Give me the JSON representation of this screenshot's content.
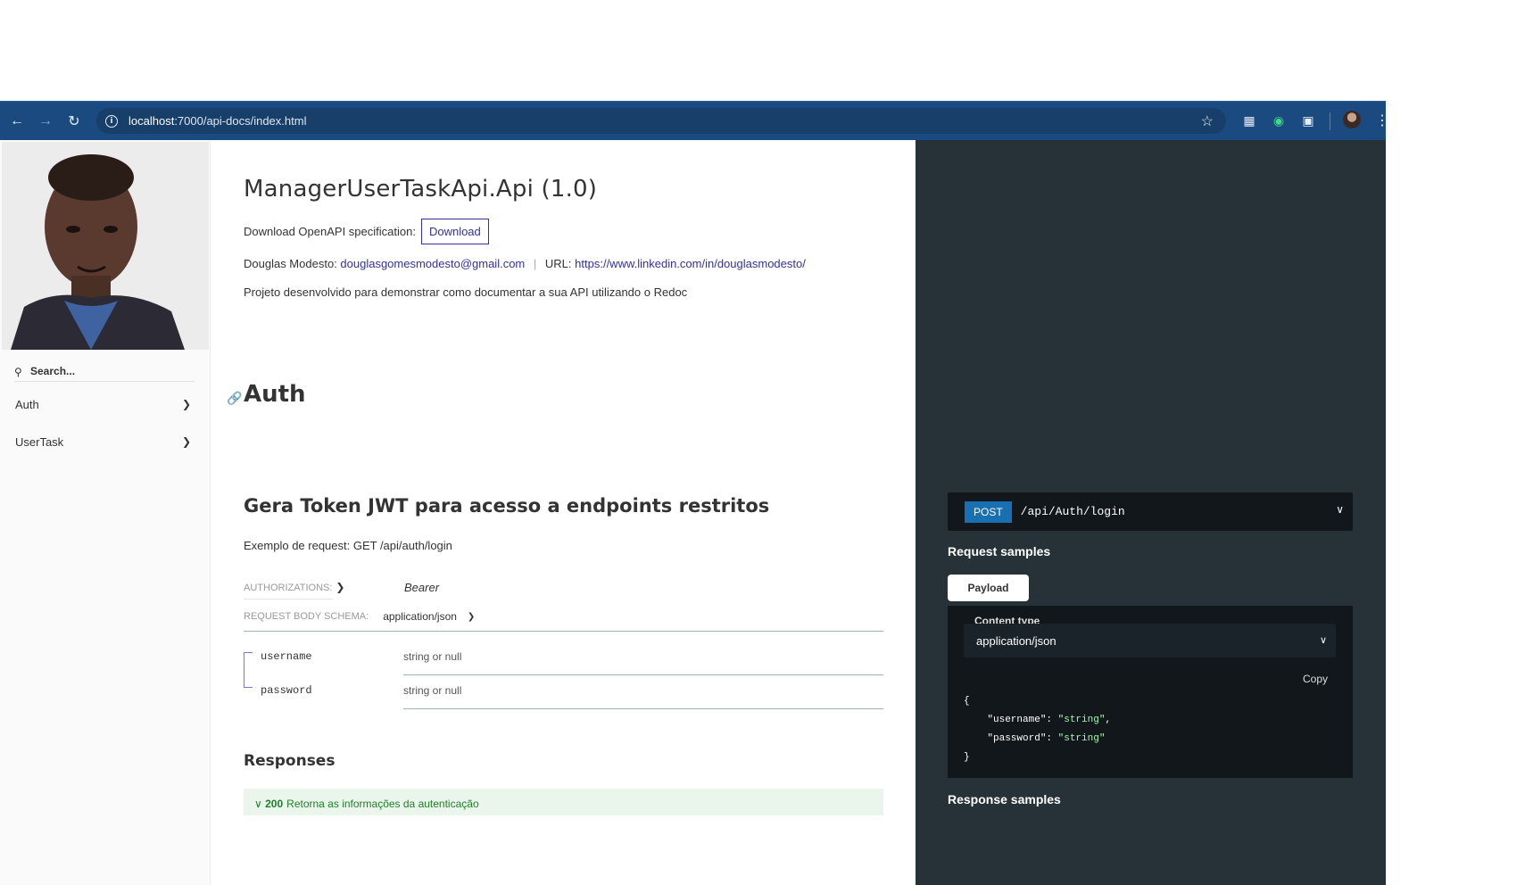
{
  "browser": {
    "url_host": "localhost",
    "url_rest": ":7000/api-docs/index.html"
  },
  "sidebar": {
    "search_placeholder": "Search...",
    "items": [
      {
        "label": "Auth"
      },
      {
        "label": "UserTask"
      }
    ]
  },
  "main": {
    "title": "ManagerUserTaskApi.Api (1.0)",
    "download_label": "Download OpenAPI specification:",
    "download_button": "Download",
    "contact_name": "Douglas Modesto:",
    "contact_email": "douglasgomesmodesto@gmail.com",
    "contact_sep": "|",
    "url_label": "URL:",
    "url_value": "https://www.linkedin.com/in/douglasmodesto/",
    "description": "Projeto desenvolvido para demonstrar como documentar a sua API utilizando o Redoc",
    "section_title": "Auth",
    "operation_title": "Gera Token JWT para acesso a endpoints restritos",
    "operation_desc": "Exemplo de request: GET /api/auth/login",
    "authorizations_label": "Authorizations:",
    "auth_value": "Bearer",
    "schema_label": "Request Body schema:",
    "schema_content_type": "application/json",
    "fields": [
      {
        "name": "username",
        "type": "string or null"
      },
      {
        "name": "password",
        "type": "string or null"
      }
    ],
    "responses_title": "Responses",
    "response_code": "200",
    "response_text": "Retorna as informações da autenticação"
  },
  "right": {
    "method": "POST",
    "path": "/api/Auth/login",
    "request_samples_title": "Request samples",
    "payload_tab": "Payload",
    "content_type_label": "Content type",
    "content_type_value": "application/json",
    "copy_label": "Copy",
    "code_open": "{",
    "code_key1": "\"username\"",
    "code_val1": "\"string\"",
    "code_key2": "\"password\"",
    "code_val2": "\"string\"",
    "code_close": "}",
    "response_samples_title": "Response samples"
  },
  "colors": {
    "chrome": "#1b4a80",
    "link": "#32329f",
    "right_panel": "#263238",
    "post_badge": "#186fb1",
    "string_green": "#a0fbaa"
  }
}
